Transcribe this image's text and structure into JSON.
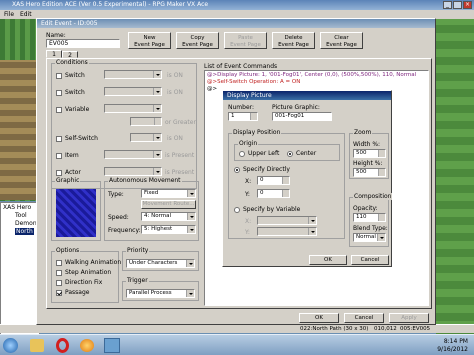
{
  "app_title": "XAS Hero Edition ACE (Ver 0.5 Experimental) - RPG Maker VX Ace",
  "menu": [
    "File",
    "Edit"
  ],
  "dialog_title": "Edit Event - ID:005",
  "name_label": "Name:",
  "name_value": "EV005",
  "buttons": {
    "new_page": "New\nEvent Page",
    "copy_page": "Copy\nEvent Page",
    "paste_page": "Paste\nEvent Page",
    "delete_page": "Delete\nEvent Page",
    "clear_page": "Clear\nEvent Page"
  },
  "page_tabs": [
    "1",
    "2"
  ],
  "conditions": {
    "title": "Conditions",
    "switch1": "Switch",
    "switch2": "Switch",
    "variable": "Variable",
    "or_greater": "or Greater",
    "self_switch": "Self-Switch",
    "item": "Item",
    "actor": "Actor",
    "is_on": "is ON",
    "is_present": "is Present"
  },
  "graphic_title": "Graphic",
  "autonomous": {
    "title": "Autonomous Movement",
    "type_label": "Type:",
    "type_value": "Fixed",
    "route_btn": "Movement Route...",
    "speed_label": "Speed:",
    "speed_value": "4: Normal",
    "freq_label": "Frequency:",
    "freq_value": "5: Highest"
  },
  "options": {
    "title": "Options",
    "walking": "Walking Animation",
    "stepping": "Step Animation",
    "direction_fix": "Direction Fix",
    "passage": "Passage",
    "passage_checked": true
  },
  "priority": {
    "title": "Priority",
    "value": "Under Characters"
  },
  "trigger": {
    "title": "Trigger",
    "value": "Parallel Process"
  },
  "commands": {
    "title": "List of Event Commands",
    "lines": [
      "@>Display Picture: 1, '001-Fog01', Center (0,0), (500%,500%), 110, Normal",
      "@>Self-Switch Operation: A = ON",
      "@>"
    ]
  },
  "bottom_buttons": {
    "ok": "OK",
    "cancel": "Cancel",
    "apply": "Apply"
  },
  "picture_dialog": {
    "title": "Display Picture",
    "number_label": "Number:",
    "number_value": "1",
    "graphic_label": "Picture Graphic:",
    "graphic_value": "001-Fog01",
    "position_title": "Display Position",
    "origin_title": "Origin",
    "upper_left": "Upper Left",
    "center": "Center",
    "specify_direct": "Specify Directly",
    "x_label": "X:",
    "x_value": "0",
    "y_label": "Y:",
    "y_value": "0",
    "specify_var": "Specify by Variable",
    "zoom_title": "Zoom",
    "width_label": "Width %:",
    "width_value": "500",
    "height_label": "Height %:",
    "height_value": "500",
    "composition_title": "Composition",
    "opacity_label": "Opacity:",
    "opacity_value": "110",
    "blend_label": "Blend Type:",
    "blend_value": "Normal",
    "ok": "OK",
    "cancel": "Cancel"
  },
  "tree": {
    "items": [
      "XAS Hero",
      "Tool",
      "Demon",
      "North"
    ]
  },
  "status": {
    "map": "022:North Path (30 x 30)",
    "coords": "010,012",
    "event": "005:EV005"
  },
  "taskbar": {
    "time": "8:14 PM",
    "date": "9/16/2012"
  }
}
